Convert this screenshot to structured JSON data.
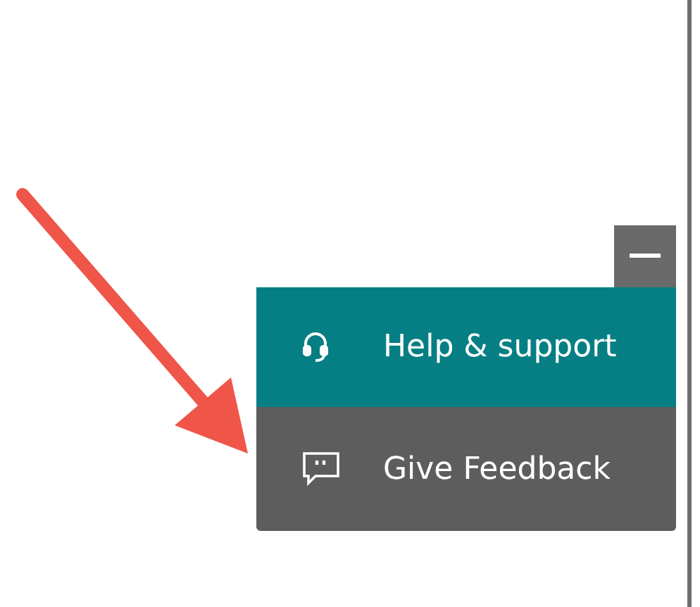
{
  "widget": {
    "buttons": [
      {
        "kind": "help",
        "label": "Help & support"
      },
      {
        "kind": "feedback",
        "label": "Give Feedback"
      }
    ]
  }
}
